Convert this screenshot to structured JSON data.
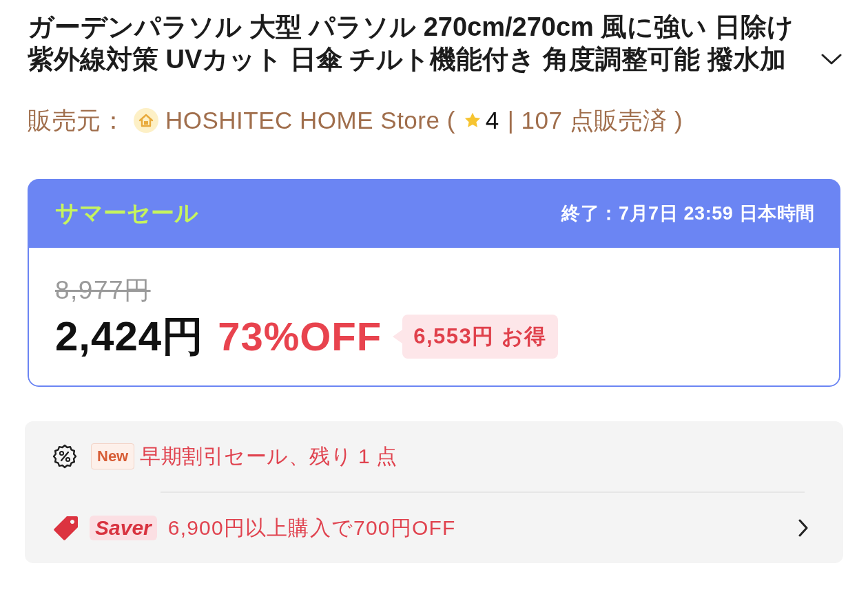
{
  "product": {
    "title": "ガーデンパラソル 大型 パラソル 270cm/270cm 風に強い 日除け紫外線対策 UVカット 日傘 チルト機能付き 角度調整可能 撥水加"
  },
  "seller": {
    "label": "販売元：",
    "store": "HOSHITEC HOME Store (",
    "rating": "4",
    "sales": "| 107 点販売済 )"
  },
  "sale": {
    "title": "サマーセール",
    "ends": "終了：7月7日 23:59 日本時間",
    "original_price": "8,977円",
    "price": "2,424円",
    "discount": "73%OFF",
    "savings": "6,553円 お得"
  },
  "promotions": [
    {
      "kind": "flash",
      "tag": "New",
      "text": "早期割引セール、残り 1 点"
    },
    {
      "kind": "saver",
      "tag": "Saver",
      "text": "6,900円以上購入で700円OFF"
    }
  ]
}
